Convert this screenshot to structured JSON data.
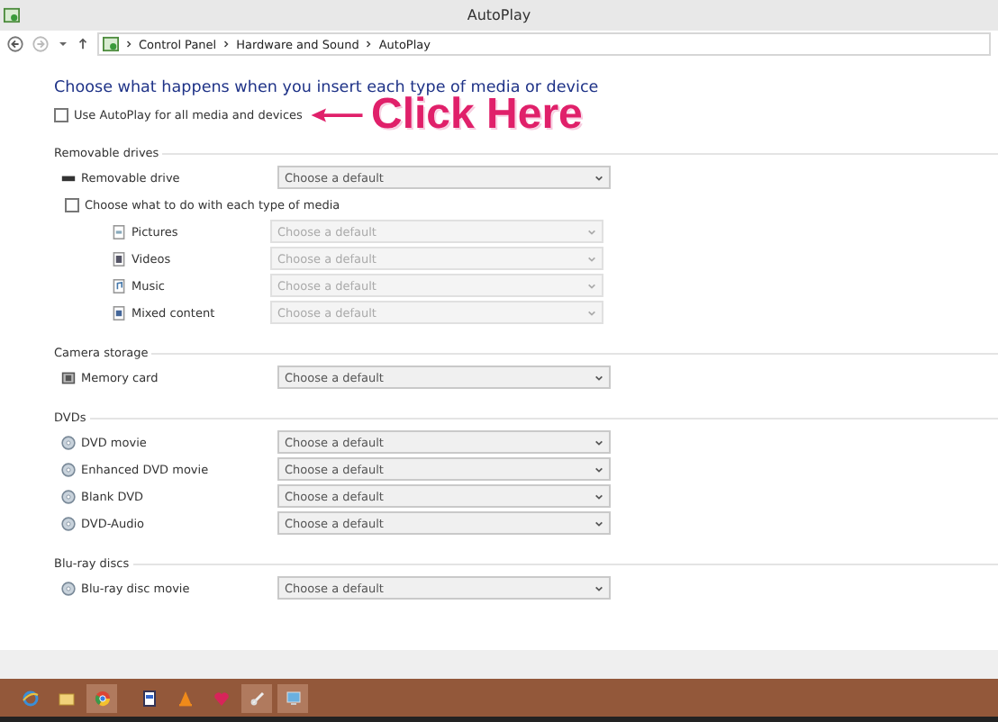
{
  "window": {
    "title": "AutoPlay"
  },
  "breadcrumb": [
    "Control Panel",
    "Hardware and Sound",
    "AutoPlay"
  ],
  "heading": "Choose what happens when you insert each type of media or device",
  "autoplay_all": {
    "label": "Use AutoPlay for all media and devices",
    "checked": false
  },
  "annotation": {
    "text": "Click Here"
  },
  "sections": [
    {
      "title": "Removable drives",
      "items": [
        {
          "kind": "device",
          "label": "Removable drive",
          "value": "Choose a default",
          "disabled": false
        },
        {
          "kind": "checkbox",
          "label": "Choose what to do with each type of media",
          "checked": false
        },
        {
          "kind": "media",
          "label": "Pictures",
          "value": "Choose a default",
          "disabled": true
        },
        {
          "kind": "media",
          "label": "Videos",
          "value": "Choose a default",
          "disabled": true
        },
        {
          "kind": "media",
          "label": "Music",
          "value": "Choose a default",
          "disabled": true
        },
        {
          "kind": "media",
          "label": "Mixed content",
          "value": "Choose a default",
          "disabled": true
        }
      ]
    },
    {
      "title": "Camera storage",
      "items": [
        {
          "kind": "device",
          "label": "Memory card",
          "value": "Choose a default",
          "disabled": false
        }
      ]
    },
    {
      "title": "DVDs",
      "items": [
        {
          "kind": "device",
          "label": "DVD movie",
          "value": "Choose a default",
          "disabled": false
        },
        {
          "kind": "device",
          "label": "Enhanced DVD movie",
          "value": "Choose a default",
          "disabled": false
        },
        {
          "kind": "device",
          "label": "Blank DVD",
          "value": "Choose a default",
          "disabled": false
        },
        {
          "kind": "device",
          "label": "DVD-Audio",
          "value": "Choose a default",
          "disabled": false
        }
      ]
    },
    {
      "title": "Blu-ray discs",
      "items": [
        {
          "kind": "device",
          "label": "Blu-ray disc movie",
          "value": "Choose a default",
          "disabled": false
        }
      ]
    }
  ],
  "taskbar": [
    {
      "selected": false
    },
    {
      "selected": false
    },
    {
      "selected": true
    },
    {
      "selected": false
    },
    {
      "selected": false
    },
    {
      "selected": false
    },
    {
      "selected": true
    },
    {
      "selected": true
    }
  ]
}
